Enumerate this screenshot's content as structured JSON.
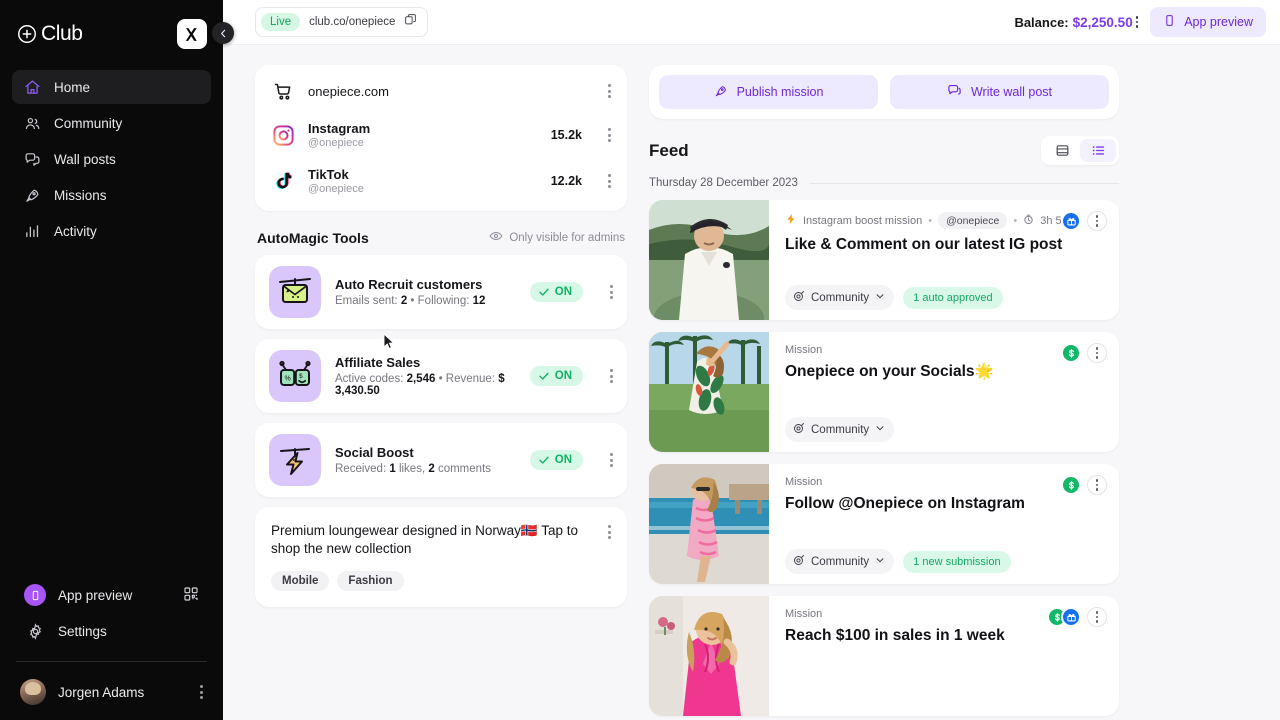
{
  "sidebar": {
    "brand": "Club",
    "brand_mark": "plus-circle-icon",
    "brand_badge": "k-logo-badge",
    "collapse_icon": "chevron-left-icon",
    "items": [
      {
        "label": "Home",
        "icon": "home-icon",
        "active": true
      },
      {
        "label": "Community",
        "icon": "users-icon",
        "active": false
      },
      {
        "label": "Wall posts",
        "icon": "chat-bubbles-icon",
        "active": false
      },
      {
        "label": "Missions",
        "icon": "rocket-icon",
        "active": false
      },
      {
        "label": "Activity",
        "icon": "bar-chart-icon",
        "active": false
      }
    ],
    "app_preview": {
      "label": "App preview",
      "icon": "phone-icon",
      "qr_icon": "qr-code-icon"
    },
    "settings": {
      "label": "Settings",
      "icon": "gear-icon"
    },
    "user": {
      "name": "Jorgen Adams",
      "avatar": "user-avatar",
      "menu_icon": "kebab-menu-icon"
    }
  },
  "topbar": {
    "status": "Live",
    "url": "club.co/onepiece",
    "copy_icon": "copy-icon",
    "balance_label": "Balance:",
    "balance_value": "$2,250.50",
    "balance_menu_icon": "kebab-menu-icon",
    "app_preview_label": "App preview",
    "app_preview_icon": "phone-icon"
  },
  "channels": [
    {
      "name": "onepiece.com",
      "handle": "",
      "count": "",
      "icon": "shopping-cart-icon"
    },
    {
      "name": "Instagram",
      "handle": "@onepiece",
      "count": "15.2k",
      "icon": "instagram-icon"
    },
    {
      "name": "TikTok",
      "handle": "@onepiece",
      "count": "12.2k",
      "icon": "tiktok-icon"
    }
  ],
  "automagic": {
    "title": "AutoMagic Tools",
    "visibility_note": "Only visible for admins",
    "visibility_icon": "eye-icon",
    "tools": [
      {
        "name": "Auto Recruit customers",
        "stat_prefix": "Emails sent: ",
        "stat_a": "2",
        "stat_mid": " • Following: ",
        "stat_b": "12",
        "stat_suffix": "",
        "toggle": "ON",
        "icon": "envelope-illustration"
      },
      {
        "name": "Affiliate Sales",
        "stat_prefix": "Active codes: ",
        "stat_a": "2,546",
        "stat_mid": " • Revenue: ",
        "stat_b": "$ 3,430.50",
        "stat_suffix": "",
        "toggle": "ON",
        "icon": "robot-illustration"
      },
      {
        "name": "Social Boost",
        "stat_prefix": "Received: ",
        "stat_a": "1",
        "stat_mid": " likes, ",
        "stat_b": "2",
        "stat_suffix": " comments",
        "toggle": "ON",
        "icon": "lightning-illustration"
      }
    ]
  },
  "promo": {
    "text": "Premium loungewear designed in Norway🇳🇴 Tap to shop the new collection",
    "tags": [
      "Mobile",
      "Fashion"
    ],
    "menu_icon": "kebab-menu-icon"
  },
  "actions": {
    "publish_mission": "Publish  mission",
    "publish_icon": "rocket-icon",
    "write_wall_post": "Write wall post",
    "write_icon": "chat-bubble-icon"
  },
  "feed": {
    "title": "Feed",
    "view_grid_icon": "card-view-icon",
    "view_list_icon": "list-view-icon",
    "active_view": "list",
    "date": "Thursday 28 December 2023",
    "items": [
      {
        "kind": "Instagram boost mission",
        "kind_icon": "lightning-bolt-icon",
        "handle": "@onepiece",
        "time": "3h 59m",
        "time_icon": "clock-icon",
        "title": "Like & Comment on our latest IG post",
        "community_label": "Community",
        "community_icon": "target-icon",
        "status": "1 auto approved",
        "badges": [
          "gift"
        ],
        "thumb": "man-in-white-polo-photo"
      },
      {
        "kind": "Mission",
        "kind_icon": "",
        "handle": "",
        "time": "",
        "time_icon": "",
        "title": "Onepiece on your Socials🌟",
        "community_label": "Community",
        "community_icon": "target-icon",
        "status": "",
        "badges": [
          "dollar"
        ],
        "thumb": "woman-in-tropical-jumpsuit-photo"
      },
      {
        "kind": "Mission",
        "kind_icon": "",
        "handle": "",
        "time": "",
        "time_icon": "",
        "title": "Follow @Onepiece on Instagram",
        "community_label": "Community",
        "community_icon": "target-icon",
        "status": "1 new submission",
        "badges": [
          "dollar"
        ],
        "thumb": "woman-by-pool-photo"
      },
      {
        "kind": "Mission",
        "kind_icon": "",
        "handle": "",
        "time": "",
        "time_icon": "",
        "title": "Reach $100 in sales in 1 week",
        "community_label": "",
        "community_icon": "",
        "status": "",
        "badges": [
          "dollar",
          "gift"
        ],
        "thumb": "woman-in-pink-suit-photo"
      }
    ]
  },
  "colors": {
    "accent_purple": "#7c3aed",
    "accent_purple_soft": "#ede9fe",
    "green": "#12b76a",
    "green_soft": "#d8f8e7",
    "blue": "#1570ef",
    "sidebar_bg": "#0a0a0b",
    "page_bg": "#f7f7f9"
  }
}
